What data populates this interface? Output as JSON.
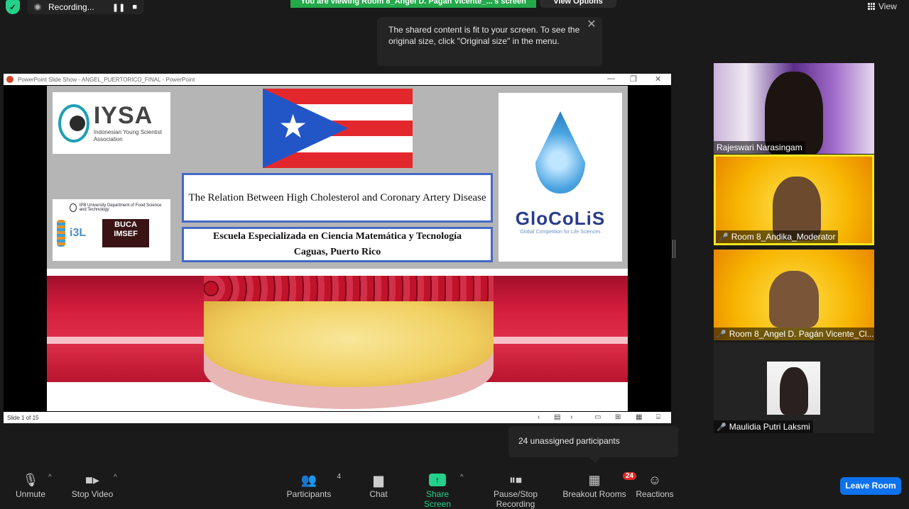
{
  "top_bar": {
    "recording_label": "Recording...",
    "viewing_banner": "You are viewing Room 8_Angel D. Pagán Vicente_...'s screen",
    "view_options_label": "View Options",
    "view_label": "View"
  },
  "tooltip": {
    "text": "The shared content is fit to your screen. To see the original size, click \"Original size\" in the menu."
  },
  "shared_window": {
    "title": "PowerPoint Slide Show  -  ANGEL_PUERTORICO_FINAL  -  PowerPoint",
    "slide_status": "Slide 1 of 15"
  },
  "slide": {
    "iysa_title": "IYSA",
    "iysa_subtitle": "Indonesian Young Scientist Association",
    "ipb_text": "IPB University  Department of Food Science and Technology",
    "i3l": "i3L",
    "buca": "BUCA IMSEF",
    "title": "The Relation Between High Cholesterol and Coronary Artery Disease",
    "school_line1": "Escuela Especializada en Ciencia Matemática y Tecnología",
    "school_line2": "Caguas, Puerto Rico",
    "glocolis_name": "GloCoLiS",
    "glocolis_sub": "Global Competition for Life Sciences"
  },
  "participants": [
    {
      "name": "Rajeswari Narasingam",
      "muted": false
    },
    {
      "name": "Room 8_Andika_Moderator",
      "muted": true
    },
    {
      "name": "Room 8_Angel D. Pagán Vicente_Cl...",
      "muted": true
    },
    {
      "name": "Maulidia Putri Laksmi",
      "muted": true
    }
  ],
  "unassigned_popup": "24 unassigned participants",
  "toolbar": {
    "unmute": "Unmute",
    "stop_video": "Stop Video",
    "participants": "Participants",
    "participants_count": "4",
    "chat": "Chat",
    "share_screen": "Share Screen",
    "pause_stop_recording": "Pause/Stop Recording",
    "breakout_rooms": "Breakout Rooms",
    "breakout_count": "24",
    "reactions": "Reactions",
    "leave_room": "Leave Room"
  },
  "colors": {
    "accent_green": "#23d18b",
    "leave_blue": "#0e72ed",
    "active_speaker": "#f2e61d"
  }
}
